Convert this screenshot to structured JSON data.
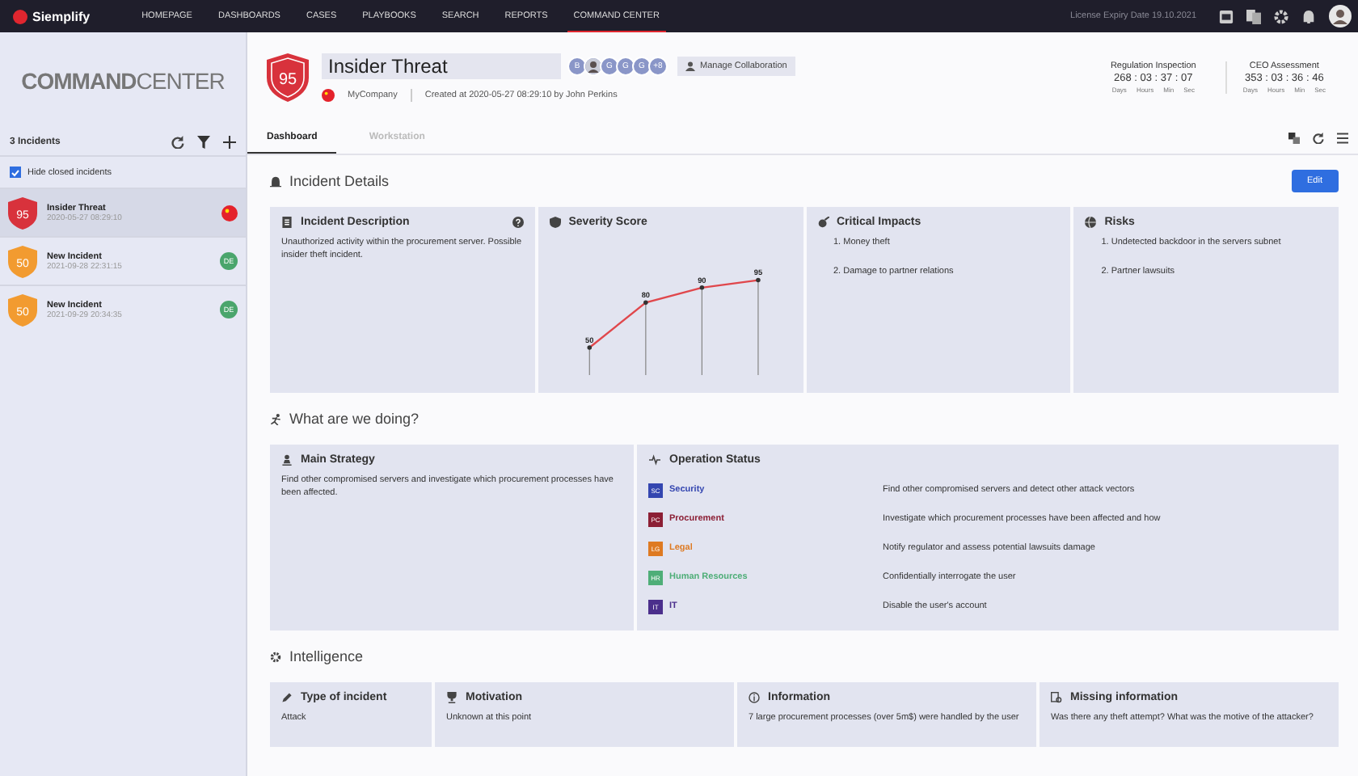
{
  "nav": {
    "brand": "Siemplify",
    "items": [
      {
        "label": "HOMEPAGE",
        "selected": false
      },
      {
        "label": "DASHBOARDS",
        "selected": false
      },
      {
        "label": "CASES",
        "selected": false
      },
      {
        "label": "PLAYBOOKS",
        "selected": false
      },
      {
        "label": "SEARCH",
        "selected": false
      },
      {
        "label": "REPORTS",
        "selected": false
      },
      {
        "label": "COMMAND CENTER",
        "selected": true
      }
    ],
    "license": "License Expiry Date 19.10.2021"
  },
  "sidebar": {
    "logo_bold": "COMMAND",
    "logo_light": "CENTER",
    "count": "3 Incidents",
    "hide_closed": {
      "label": "Hide closed incidents",
      "checked": true
    },
    "incidents": [
      {
        "score": "95",
        "color": "#d8323c",
        "title": "Insider Threat",
        "date": "2020-05-27 08:29:10",
        "kind": "flag",
        "selected": true
      },
      {
        "score": "50",
        "color": "#f29b30",
        "title": "New Incident",
        "date": "2021-09-28 22:31:15",
        "kind": "badge",
        "badge": "DE",
        "selected": false
      },
      {
        "score": "50",
        "color": "#f29b30",
        "title": "New Incident",
        "date": "2021-09-29 20:34:35",
        "kind": "badge",
        "badge": "DE",
        "selected": false
      }
    ]
  },
  "header": {
    "score": "95",
    "title": "Insider Threat",
    "avatars": [
      {
        "kind": "letter",
        "label": "B"
      },
      {
        "kind": "photo"
      },
      {
        "kind": "letter",
        "label": "G"
      },
      {
        "kind": "letter",
        "label": "G"
      },
      {
        "kind": "letter",
        "label": "G"
      },
      {
        "kind": "letter",
        "label": "+8"
      }
    ],
    "collab_button": "Manage Collaboration",
    "company": "MyCompany",
    "created": "Created at 2020-05-27 08:29:10 by John Perkins",
    "timers": [
      {
        "title": "Regulation Inspection",
        "value": "268 : 03 : 37 : 07",
        "units": [
          "Days",
          "Hours",
          "Min",
          "Sec"
        ]
      },
      {
        "title": "CEO Assessment",
        "value": "353 : 03 : 36 : 46",
        "units": [
          "Days",
          "Hours",
          "Min",
          "Sec"
        ]
      }
    ]
  },
  "tabs": [
    {
      "label": "Dashboard",
      "selected": true
    },
    {
      "label": "Workstation",
      "selected": false
    }
  ],
  "incident_details": {
    "title": "Incident Details",
    "edit": "Edit",
    "description": {
      "title": "Incident Description",
      "text": "Unauthorized activity within the procurement server. Possible insider theft incident."
    },
    "severity": {
      "title": "Severity Score",
      "chart_data": {
        "type": "line",
        "series": [
          {
            "color": "#e0474c",
            "values": [
              50,
              80,
              90,
              95
            ]
          }
        ],
        "data_labels": true,
        "grid": true
      }
    },
    "impacts": {
      "title": "Critical Impacts",
      "items": [
        "1. Money theft",
        "2. Damage to partner relations"
      ]
    },
    "risks": {
      "title": "Risks",
      "items": [
        "1. Undetected backdoor in the servers subnet",
        "2. Partner lawsuits"
      ]
    }
  },
  "doing": {
    "title": "What are we doing?",
    "strategy": {
      "title": "Main Strategy",
      "text": "Find other compromised servers and investigate which procurement processes have been affected."
    },
    "operations": {
      "title": "Operation Status",
      "rows": [
        {
          "code": "SC",
          "team": "Security",
          "color": "#3446b0",
          "action": "Find other compromised servers and detect other attack vectors"
        },
        {
          "code": "PC",
          "team": "Procurement",
          "color": "#8c1f35",
          "action": "Investigate which procurement processes have been affected and how"
        },
        {
          "code": "LG",
          "team": "Legal",
          "color": "#de7a22",
          "action": "Notify regulator and assess potential lawsuits damage"
        },
        {
          "code": "HR",
          "team": "Human Resources",
          "color": "#4fae78",
          "action": "Confidentially interrogate the user"
        },
        {
          "code": "IT",
          "team": "IT",
          "color": "#4b2f8c",
          "action": "Disable the user's account"
        }
      ]
    }
  },
  "intelligence": {
    "title": "Intelligence",
    "cards": [
      {
        "kind": "type",
        "title": "Type of incident",
        "text": "Attack"
      },
      {
        "kind": "motivation",
        "title": "Motivation",
        "text": "Unknown at this point"
      },
      {
        "kind": "info",
        "title": "Information",
        "text": "7 large procurement processes (over 5m$) were handled by the user"
      },
      {
        "kind": "missing",
        "title": "Missing information",
        "text": "Was there any theft attempt? What was the motive of the attacker?"
      }
    ]
  }
}
